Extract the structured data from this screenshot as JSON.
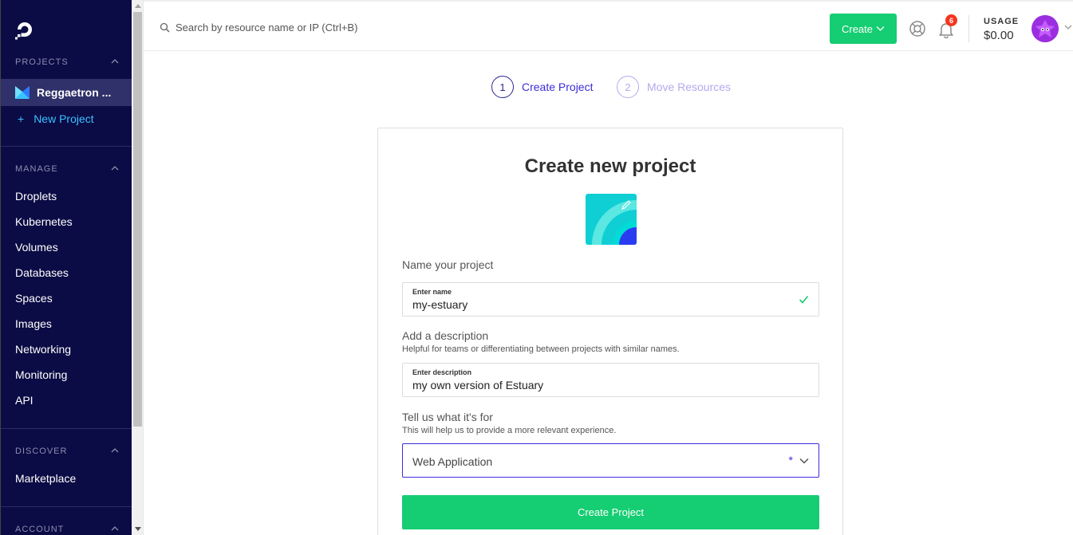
{
  "sidebar": {
    "projects_header": "PROJECTS",
    "active_project": "Reggaetron ...",
    "new_project": "New Project",
    "manage_header": "MANAGE",
    "manage_items": [
      "Droplets",
      "Kubernetes",
      "Volumes",
      "Databases",
      "Spaces",
      "Images",
      "Networking",
      "Monitoring",
      "API"
    ],
    "discover_header": "DISCOVER",
    "discover_items": [
      "Marketplace"
    ],
    "account_header": "ACCOUNT"
  },
  "topbar": {
    "search_placeholder": "Search by resource name or IP (Ctrl+B)",
    "create_label": "Create",
    "notification_count": "6",
    "usage_label": "USAGE",
    "usage_value": "$0.00"
  },
  "stepper": [
    {
      "number": "1",
      "label": "Create Project",
      "state": "active"
    },
    {
      "number": "2",
      "label": "Move Resources",
      "state": "inactive"
    }
  ],
  "form": {
    "title": "Create new project",
    "name_section": "Name your project",
    "name_field_label": "Enter name",
    "name_value": "my-estuary",
    "description_section": "Add a description",
    "description_help": "Helpful for teams or differentiating between projects with similar names.",
    "description_field_label": "Enter description",
    "description_value": "my own version of Estuary",
    "purpose_section": "Tell us what it's for",
    "purpose_help": "This will help us to provide a more relevant experience.",
    "purpose_value": "Web Application",
    "required_marker": "*",
    "submit_label": "Create Project"
  },
  "colors": {
    "sidebar_bg": "#0b0b45",
    "accent_green": "#15cd72",
    "accent_blue": "#3d2cd9",
    "link_blue": "#39c3ff",
    "badge_red": "#f5361f"
  }
}
